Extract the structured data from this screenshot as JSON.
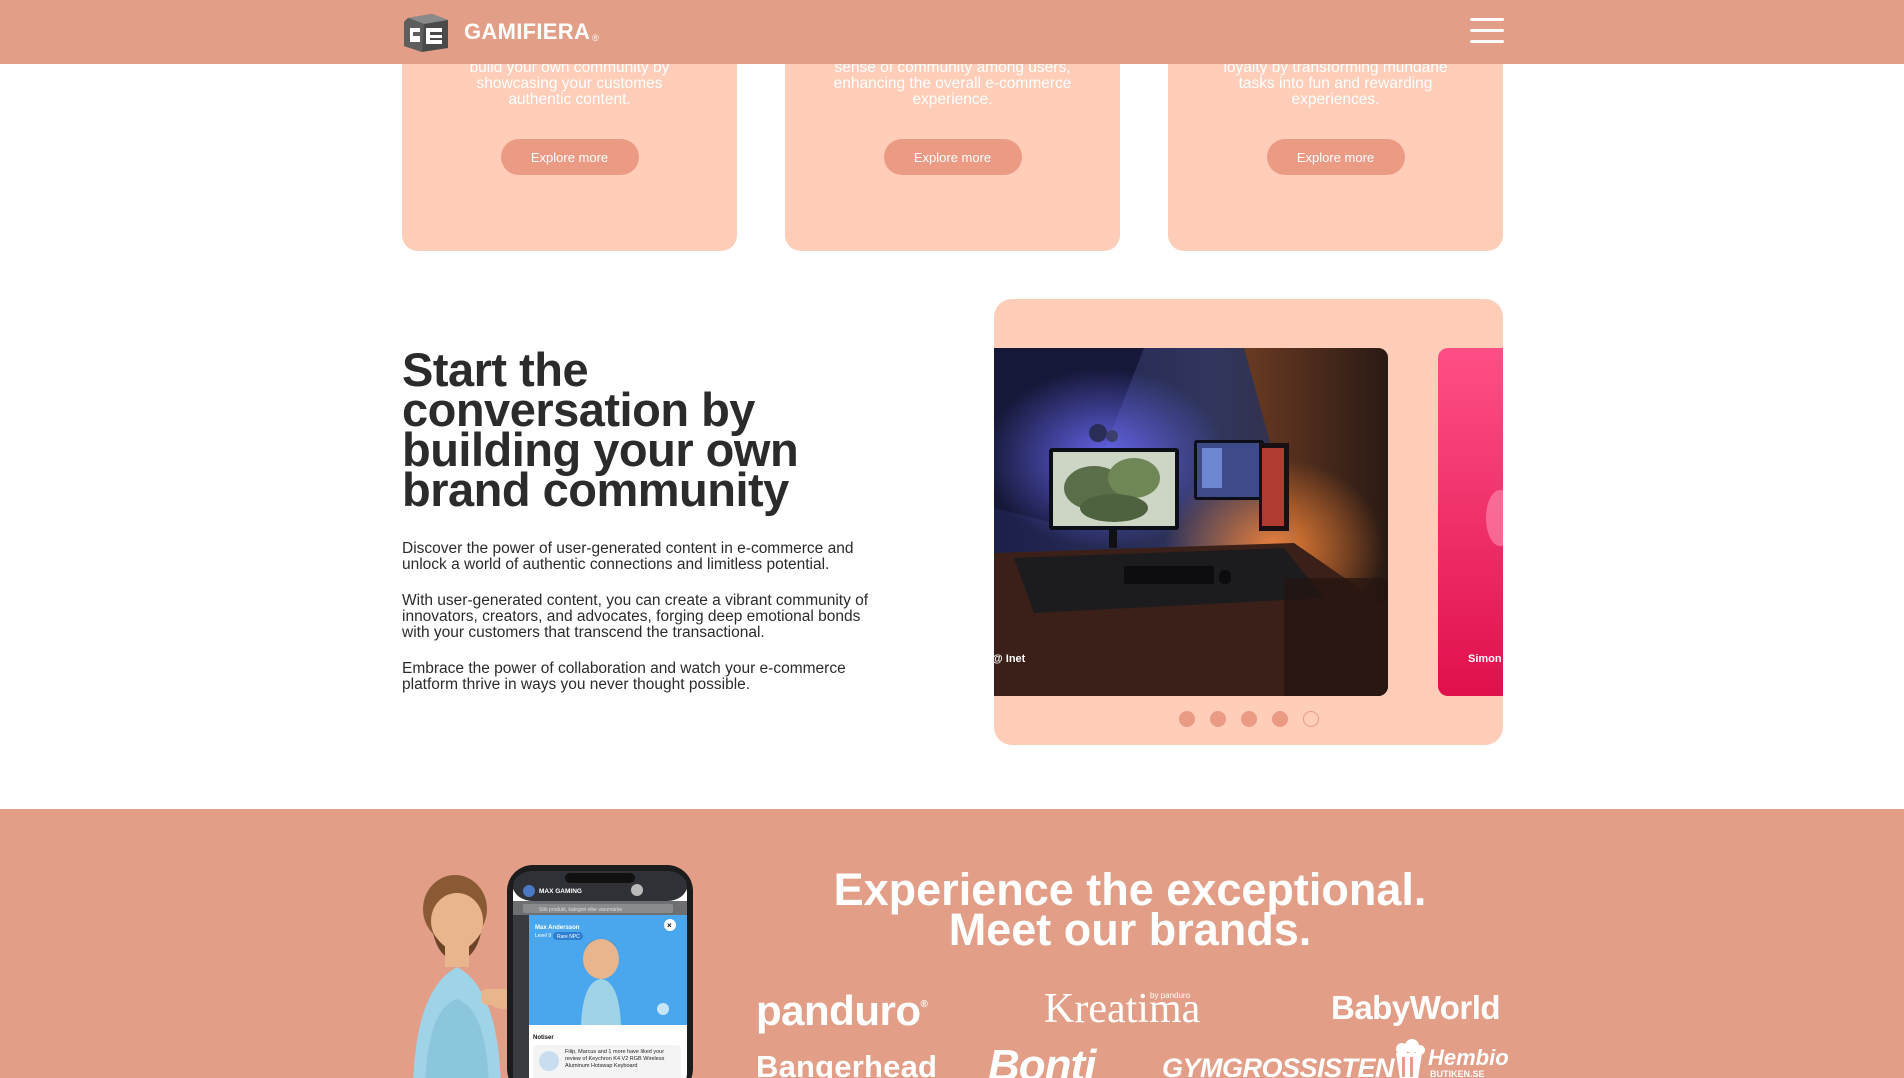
{
  "header": {
    "brand": "GAMIFIERA",
    "registered": "®"
  },
  "cards": [
    {
      "line_cut": "build your own community by",
      "lines": [
        "showcasing your customes",
        "authentic content."
      ],
      "button": "Explore more"
    },
    {
      "line_cut": "sense of community among users,",
      "lines": [
        "enhancing the overall e-commerce",
        "experience."
      ],
      "button": "Explore more"
    },
    {
      "line_cut": "loyalty by transforming mundane",
      "lines": [
        "tasks into fun and rewarding",
        "experiences."
      ],
      "button": "Explore more"
    }
  ],
  "conversation": {
    "title": "Start the conversation by building your own brand community",
    "p1": "Discover the power of user-generated content in e-commerce and unlock a world of authentic connections and limitless potential.",
    "p2": "With user-generated content, you can create a vibrant community of innovators, creators, and advocates, forging deep emotional bonds with your customers that transcend the transactional.",
    "p3": "Embrace the power of collaboration and watch your e-commerce platform thrive in ways you never thought possible."
  },
  "slider": {
    "slides": [
      {
        "caption": "@ Inet"
      },
      {
        "caption": "Simon"
      }
    ],
    "dot_count": 5,
    "active_dot": 5
  },
  "brands_section": {
    "title_line1": "Experience the exceptional.",
    "title_line2": "Meet our brands.",
    "logos": {
      "panduro": "panduro",
      "kreatima": "Kreatima",
      "kreatima_sub": "by panduro",
      "babyworld": "BabyWorld",
      "bangerhead": "Bangerhead",
      "bonti": "Bonti",
      "gymgrossisten": "GYMGROSSISTEN",
      "hembio": "Hembio",
      "hembio_sub": "BUTIKEN.SE"
    },
    "phone": {
      "store": "MAX GAMING",
      "search_placeholder": "Sök produkt, kategori eller varumärke",
      "user_name": "Max Andersson",
      "user_level": "Level 9",
      "user_badge": "Rare NPC",
      "notifications_label": "Notiser",
      "notification_text": "Filip, Marcus and 1 more have liked your review of Keychron K4 V2 RGB Wireless Aluminum Hotswap Keyboard"
    }
  },
  "colors": {
    "header": "#e29e86",
    "card": "#ffcdb8",
    "button": "#eb9a84",
    "text_dark": "#2b2b2b"
  }
}
